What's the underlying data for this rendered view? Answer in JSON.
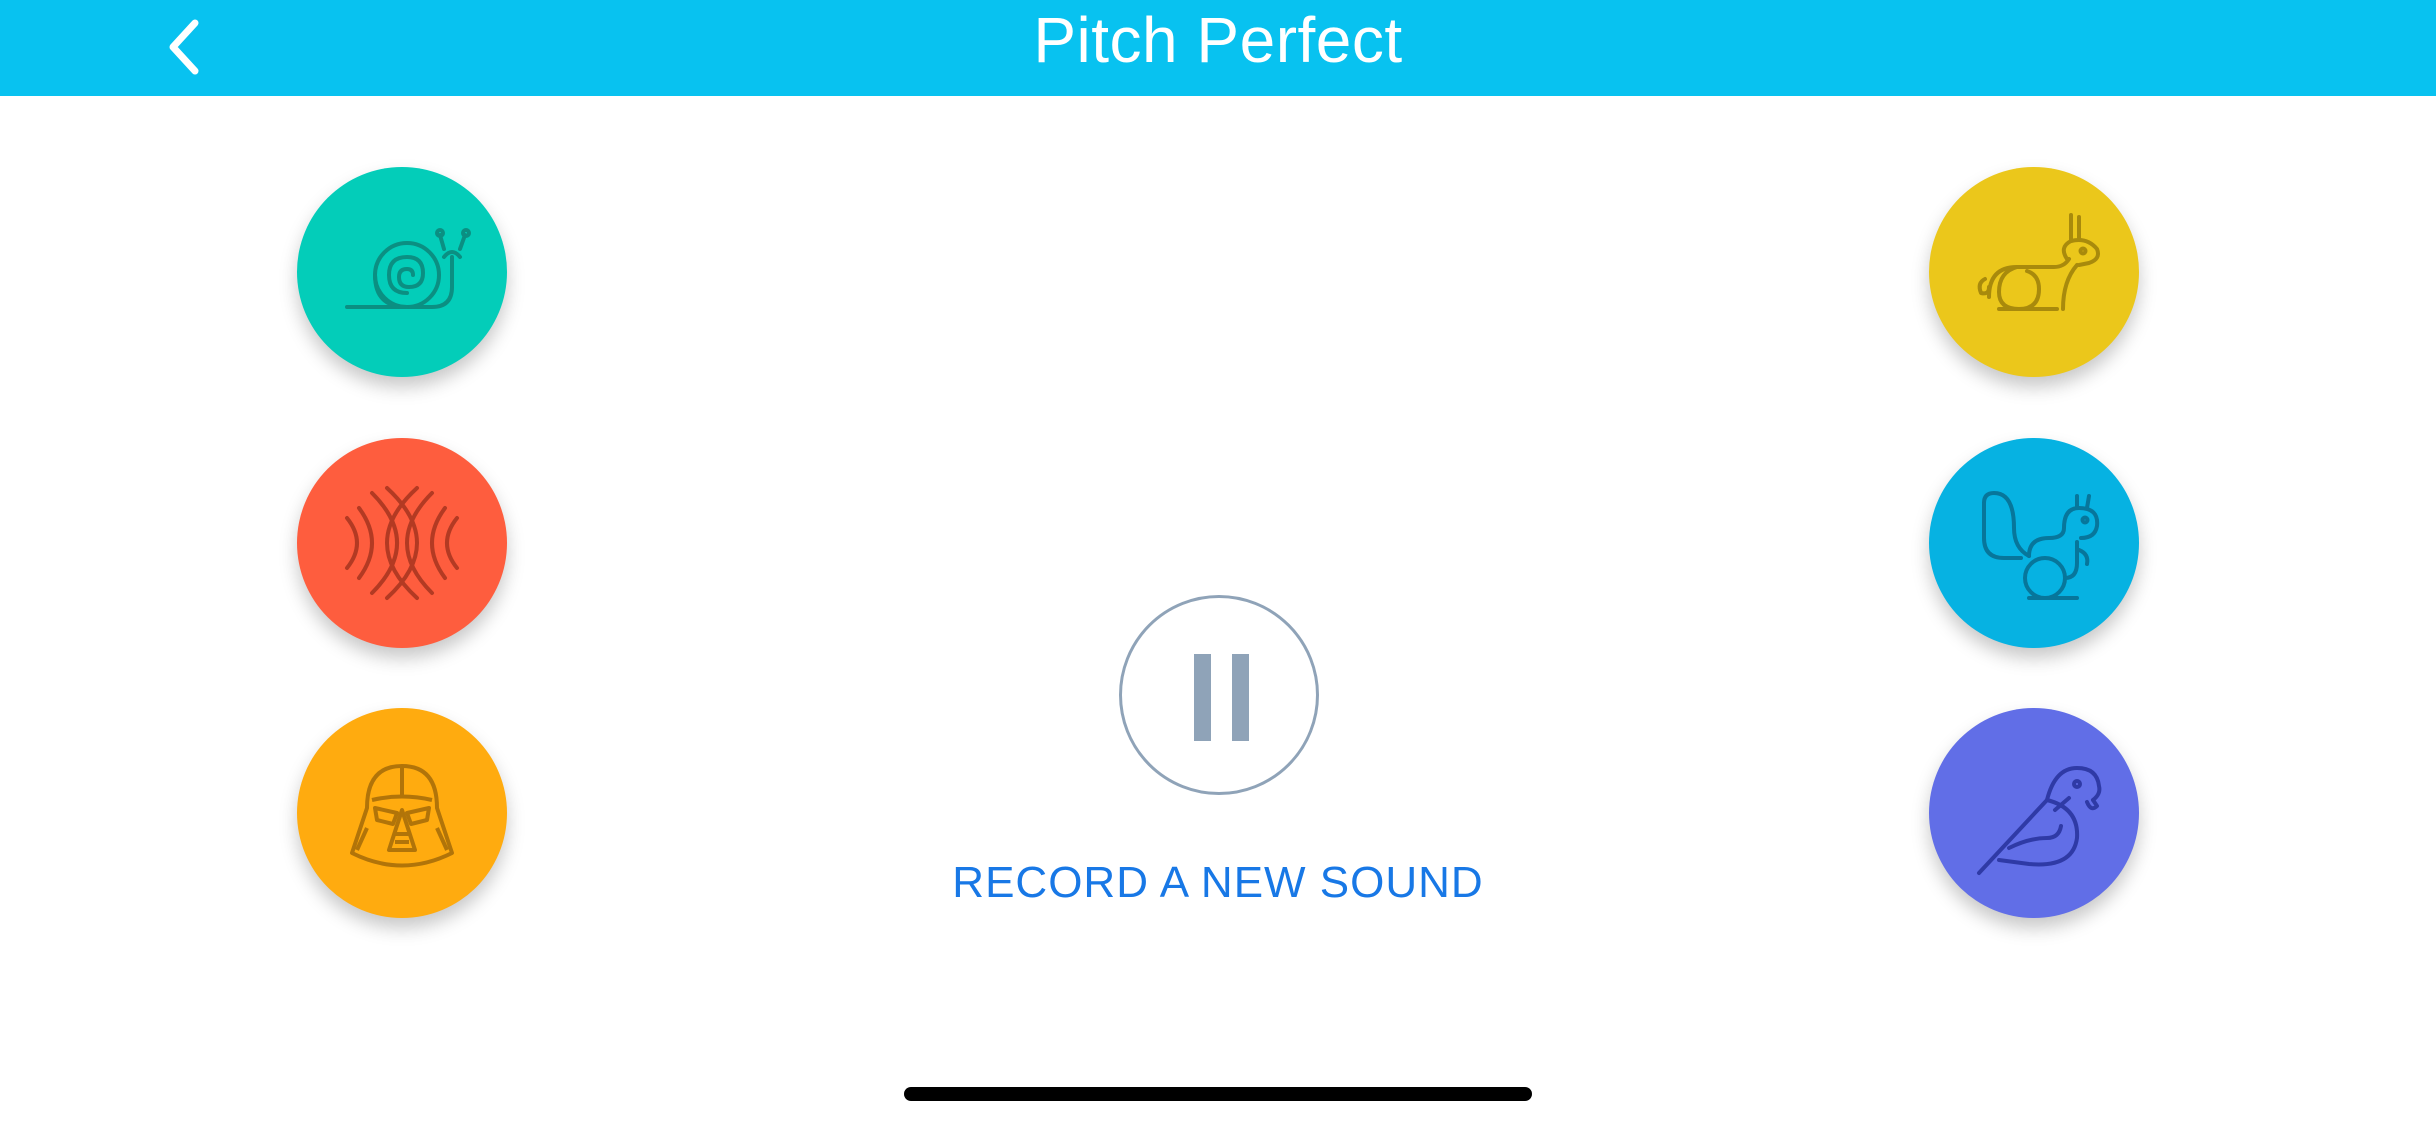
{
  "app": {
    "title": "Pitch Perfect"
  },
  "navbar": {
    "back_icon": "chevron-left-icon",
    "background_color": "#08c2f0"
  },
  "effects": {
    "left": [
      {
        "name": "slow",
        "icon": "snail-icon",
        "color": "#03cdb9"
      },
      {
        "name": "echo",
        "icon": "echo-waves-icon",
        "color": "#fe5d3e"
      },
      {
        "name": "darth-vader",
        "icon": "darth-vader-icon",
        "color": "#ffab0f"
      }
    ],
    "right": [
      {
        "name": "fast",
        "icon": "rabbit-icon",
        "color": "#ebc71b"
      },
      {
        "name": "chipmunk",
        "icon": "squirrel-icon",
        "color": "#06b2e2"
      },
      {
        "name": "reverb",
        "icon": "parrot-icon",
        "color": "#616ee7"
      }
    ]
  },
  "playback": {
    "stop_icon": "pause-icon",
    "record_label": "RECORD A NEW SOUND"
  }
}
